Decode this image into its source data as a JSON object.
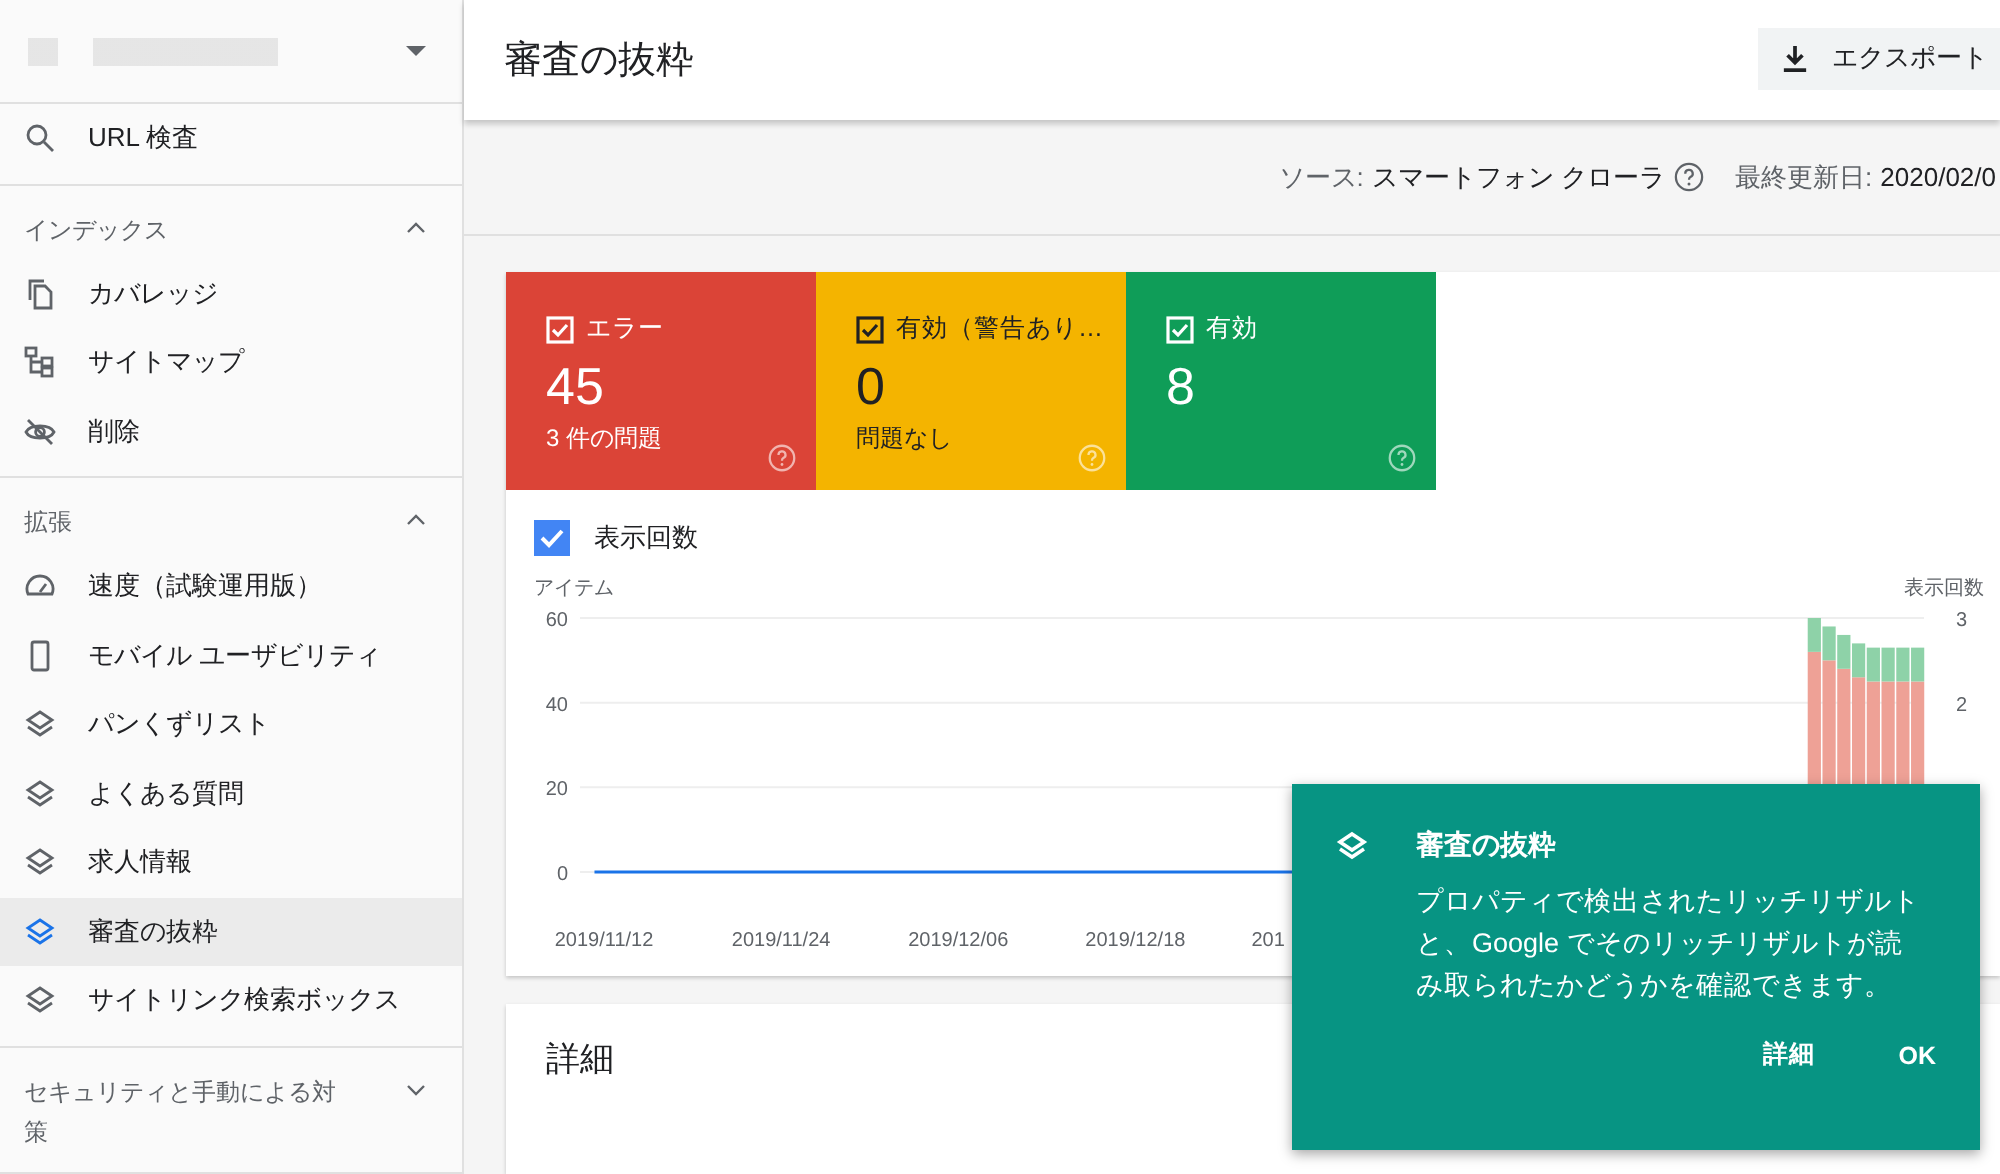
{
  "sidebar": {
    "sections": [
      {
        "items": [
          {
            "kind": "search",
            "label": "URL 検査",
            "selected": false
          }
        ]
      },
      {
        "title": "インデックス",
        "expanded": true,
        "items": [
          {
            "kind": "pages",
            "label": "カバレッジ",
            "selected": false
          },
          {
            "kind": "sitemap",
            "label": "サイトマップ",
            "selected": false
          },
          {
            "kind": "hidden",
            "label": "削除",
            "selected": false
          }
        ]
      },
      {
        "title": "拡張",
        "expanded": true,
        "items": [
          {
            "kind": "gauge",
            "label": "速度（試験運用版）",
            "selected": false
          },
          {
            "kind": "phone",
            "label": "モバイル ユーザビリティ",
            "selected": false
          },
          {
            "kind": "layers",
            "label": "パンくずリスト",
            "selected": false
          },
          {
            "kind": "layers",
            "label": "よくある質問",
            "selected": false
          },
          {
            "kind": "layers",
            "label": "求人情報",
            "selected": false
          },
          {
            "kind": "layers",
            "label": "審査の抜粋",
            "selected": true
          },
          {
            "kind": "layers",
            "label": "サイトリンク検索ボックス",
            "selected": false
          }
        ]
      },
      {
        "title": "セキュリティと手動による対策",
        "expanded": false
      }
    ]
  },
  "header": {
    "title": "審査の抜粋",
    "export_button": "エクスポート"
  },
  "source_bar": {
    "source_label": "ソース:",
    "source": "スマートフォン クローラ",
    "updated_label": "最終更新日:",
    "updated": "2020/02/0"
  },
  "status_cards": [
    {
      "kind": "error",
      "label": "エラー",
      "count": "45",
      "subtitle": "3 件の問題",
      "checked": true,
      "color": "#db4437"
    },
    {
      "kind": "warning",
      "label": "有効（警告あり…",
      "count": "0",
      "subtitle": "問題なし",
      "checked": true,
      "color": "#f4b400"
    },
    {
      "kind": "valid",
      "label": "有効",
      "count": "8",
      "checked": true,
      "color": "#0f9d58"
    }
  ],
  "impressions_toggle": {
    "label": "表示回数",
    "checked": true
  },
  "chart": {
    "right_axis_label": "表示回数",
    "right_ticks": [
      "3",
      "2"
    ],
    "chart_data": {
      "type": "bar",
      "stacked": true,
      "ylabel": "アイテム",
      "x": [
        "2020-02-02",
        "2020-02-03",
        "2020-02-04",
        "2020-02-05",
        "2020-02-06",
        "2020-02-07",
        "2020-02-08",
        "2020-02-09"
      ],
      "xlim": [
        "2019-11-10",
        "2020-02-09"
      ],
      "ylim": [
        0,
        60
      ],
      "yticks": [
        0,
        20,
        40,
        60
      ],
      "xticks": [
        {
          "value": "2019-11-12",
          "label": "2019/11/12"
        },
        {
          "value": "2019-11-24",
          "label": "2019/11/24"
        },
        {
          "value": "2019-12-06",
          "label": "2019/12/06"
        },
        {
          "value": "2019-12-18",
          "label": "2019/12/18"
        },
        {
          "value": "2019-12-27",
          "label": "201"
        }
      ],
      "series": [
        {
          "color": "#eea196",
          "values": [
            52,
            50,
            48,
            46,
            45,
            45,
            45,
            45
          ]
        },
        {
          "color": "#8ed2a8",
          "values": [
            8,
            8,
            8,
            8,
            8,
            8,
            8,
            8
          ]
        }
      ]
    }
  },
  "details_card": {
    "title": "詳細"
  },
  "popup": {
    "title": "審査の抜粋",
    "body": "プロパティで検出されたリッチリザルトと、Google でそのリッチリザルトが読み取られたかどうかを確認できます。",
    "buttons": [
      "詳細",
      "OK"
    ]
  }
}
